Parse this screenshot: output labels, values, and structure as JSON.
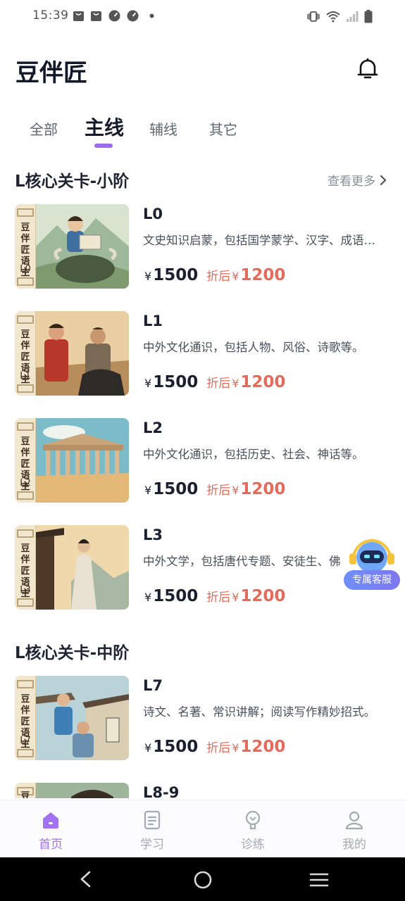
{
  "status_bar": {
    "time": "15:39"
  },
  "header": {
    "title": "豆伴匠"
  },
  "tabs": [
    "全部",
    "主线",
    "辅线",
    "其它"
  ],
  "sections": [
    {
      "title": "L核心关卡-小阶",
      "see_more": "查看更多",
      "courses": [
        {
          "level": "L0",
          "desc": "文史知识启蒙，包括国学蒙学、汉字、成语…",
          "badge_text": "豆伴匠语主",
          "price": "1500",
          "discount_label": "折后",
          "discount_price": "1200"
        },
        {
          "level": "L1",
          "desc": "中外文化通识，包括人物、风俗、诗歌等。",
          "badge_text": "豆伴匠语主",
          "price": "1500",
          "discount_label": "折后",
          "discount_price": "1200"
        },
        {
          "level": "L2",
          "desc": "中外文化通识，包括历史、社会、神话等。",
          "badge_text": "豆伴匠语主",
          "price": "1500",
          "discount_label": "折后",
          "discount_price": "1200"
        },
        {
          "level": "L3",
          "desc": "中外文学，包括唐代专题、安徒生、佛",
          "badge_text": "豆伴匠语主",
          "price": "1500",
          "discount_label": "折后",
          "discount_price": "1200"
        }
      ]
    },
    {
      "title": "L核心关卡-中阶",
      "courses": [
        {
          "level": "L7",
          "desc": "诗文、名著、常识讲解；阅读写作精妙招式。",
          "badge_text": "豆伴匠语主",
          "price": "1500",
          "discount_label": "折后",
          "discount_price": "1200"
        },
        {
          "level": "L8-9",
          "badge_text": "豆"
        }
      ]
    }
  ],
  "currency_symbol": "¥",
  "floating_service": {
    "label": "专属客服"
  },
  "bottom_nav": [
    "首页",
    "学习",
    "诊练",
    "我的"
  ],
  "colors": {
    "accent": "#9b6cf0",
    "discount": "#e56a5a",
    "text": "#1b2030"
  }
}
